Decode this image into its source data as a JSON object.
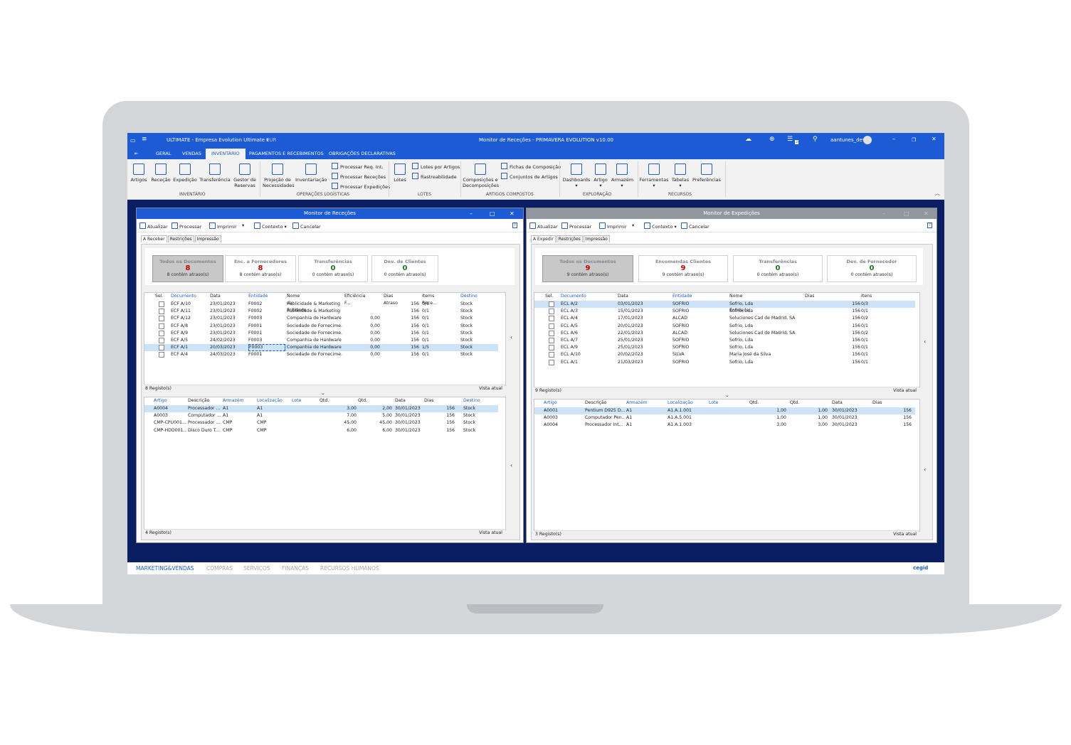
{
  "titlebar": {
    "company": "ULTIMATE - Empresa Evolution Ultimate ▾",
    "currency": "EUR",
    "title": "Monitor de Receções - PRIMAVERA EVOLUTION v10.00",
    "user": "aantunes_dev",
    "notif_count": "2"
  },
  "menu": [
    "GERAL",
    "VENDAS",
    "INVENTÁRIO",
    "PAGAMENTOS E RECEBIMENTOS",
    "OBRIGAÇÕES DECLARATIVAS"
  ],
  "ribbon": {
    "inventario": [
      "Artigos",
      "Receção",
      "Expedição",
      "Transferência",
      "Gestor de\nReservas"
    ],
    "inventario_group": "INVENTÁRIO",
    "oplog": [
      "Projeção de\nNecessidades",
      "Inventariação"
    ],
    "oplog_small": [
      "Processar Req. Int.",
      "Processar Receções",
      "Processar Expedições"
    ],
    "oplog_group": "OPERAÇÕES LOGÍSTICAS",
    "lotes": [
      "Lotes"
    ],
    "lotes_small": [
      "Lotes por Artigos",
      "Rastreabilidade"
    ],
    "lotes_group": "LOTES",
    "compostos": [
      "Composições e\nDecomposições"
    ],
    "compostos_small": [
      "Fichas de Composição",
      "Conjuntos de Artigos"
    ],
    "compostos_group": "ARTIGOS COMPOSTOS",
    "exploracao": [
      "Dashboards",
      "Artigo",
      "Armazém"
    ],
    "exploracao_group": "EXPLORAÇÃO",
    "recursos": [
      "Ferramentas",
      "Tabelas",
      "Preferências"
    ],
    "recursos_group": "RECURSOS"
  },
  "toolbar": {
    "atualizar": "Atualizar",
    "processar": "Processar",
    "imprimir": "Imprimir",
    "imprimir_arrow": "▾",
    "contexto": "Contexto ▾",
    "cancelar": "Cancelar",
    "help": "?"
  },
  "rececoes": {
    "title": "Monitor de Receções",
    "tabs": [
      "A Receber",
      "Restrições",
      "Impressão"
    ],
    "cards": [
      {
        "label": "Todos os Documentos",
        "num": "8",
        "sub": "8 contém atraso(s)",
        "color": "#c00000"
      },
      {
        "label": "Enc. a Fornecedores",
        "num": "8",
        "sub": "8 contém atraso(s)",
        "color": "#c00000"
      },
      {
        "label": "Transferências",
        "num": "0",
        "sub": "0 contém atraso(s)",
        "color": "#1a7a1a"
      },
      {
        "label": "Dev. de Clientes",
        "num": "0",
        "sub": "0 contém atraso(s)",
        "color": "#1a7a1a"
      }
    ],
    "docs_head": [
      "Sel.",
      "Documento",
      "Data",
      "Entidade",
      "Nome da Entidade",
      "Eficiência F...",
      "Dias Atraso",
      "Items Rece...",
      "Destino"
    ],
    "docs": [
      [
        "ECF A/10",
        "23/01/2023",
        "F0002",
        "Publicidade & Marketing",
        "",
        "156",
        "0/1",
        "Stock"
      ],
      [
        "ECF A/11",
        "23/01/2023",
        "F0002",
        "Publicidade & Marketing",
        "",
        "156",
        "0/1",
        "Stock"
      ],
      [
        "ECF A/12",
        "23/01/2023",
        "F0003",
        "Companhia de Hardware",
        "0,00",
        "156",
        "0/1",
        "Stock"
      ],
      [
        "ECF A/8",
        "23/01/2023",
        "F0001",
        "Sociedade de Fornecime...",
        "0,00",
        "156",
        "0/1",
        "Stock"
      ],
      [
        "ECF A/9",
        "23/01/2023",
        "F0001",
        "Sociedade de Fornecime...",
        "0,00",
        "156",
        "0/1",
        "Stock"
      ],
      [
        "ECF A/5",
        "24/02/2023",
        "F0003",
        "Companhia de Hardware",
        "0,00",
        "156",
        "0/1",
        "Stock"
      ],
      [
        "ECF A/1",
        "20/03/2023",
        "F0003",
        "Companhia de Hardware",
        "0,00",
        "156",
        "1/5",
        "Stock"
      ],
      [
        "ECF A/4",
        "24/03/2023",
        "F0001",
        "Sociedade de Fornecime...",
        "0,00",
        "156",
        "0/1",
        "Stock"
      ]
    ],
    "docs_count": "8 Registo(s)",
    "view": "Vista atual",
    "lines_head": [
      "Artigo",
      "Descrição",
      "Armazém",
      "Localização",
      "Lote",
      "Qtd.",
      "Qtd. Pend.",
      "Data Prevista",
      "Dias Atraso",
      "Destino"
    ],
    "lines": [
      [
        "A0004",
        "Processador ...",
        "A1",
        "A1",
        "",
        "3,00",
        "2,00",
        "30/01/2023",
        "156",
        "Stock"
      ],
      [
        "A0003",
        "Computador ...",
        "A1",
        "A1",
        "",
        "7,00",
        "5,00",
        "30/01/2023",
        "156",
        "Stock"
      ],
      [
        "CMP-CPU001...",
        "Processador ...",
        "CMP",
        "CMP",
        "",
        "45,00",
        "45,00",
        "30/01/2023",
        "156",
        "Stock"
      ],
      [
        "CMP-HDD001...",
        "Disco Duro T...",
        "CMP",
        "CMP",
        "",
        "6,00",
        "6,00",
        "30/01/2023",
        "156",
        "Stock"
      ]
    ],
    "lines_count": "4 Registo(s)"
  },
  "expedicoes": {
    "title": "Monitor de Expedições",
    "tabs": [
      "A Expedir",
      "Restrições",
      "Impressão"
    ],
    "cards": [
      {
        "label": "Todos os Documentos",
        "num": "9",
        "sub": "9 contém atraso(s)",
        "color": "#c00000"
      },
      {
        "label": "Encomendas Clientes",
        "num": "9",
        "sub": "9 contém atraso(s)",
        "color": "#c00000"
      },
      {
        "label": "Transferências",
        "num": "0",
        "sub": "0 contém atraso(s)",
        "color": "#1a7a1a"
      },
      {
        "label": "Dev. de Fornecedor",
        "num": "0",
        "sub": "0 contém atraso(s)",
        "color": "#1a7a1a"
      }
    ],
    "docs_head": [
      "Sel.",
      "Documento",
      "Data",
      "Entidade",
      "Nome da Entidade",
      "Dias Atraso",
      "Itens Expedidos"
    ],
    "docs": [
      [
        "ECL A/2",
        "03/01/2023",
        "SOFRIO",
        "Sofrio, Lda",
        "156",
        "0/3"
      ],
      [
        "ECL A/3",
        "15/01/2023",
        "SOFRIO",
        "Sofrio, Lda",
        "156",
        "0/1"
      ],
      [
        "ECL A/4",
        "17/01/2023",
        "ALCAD",
        "Soluciones Cad de Madrid, SA",
        "156",
        "0/2"
      ],
      [
        "ECL A/5",
        "20/01/2023",
        "SOFRIO",
        "Sofrio, Lda",
        "156",
        "0/1"
      ],
      [
        "ECL A/6",
        "22/01/2023",
        "ALCAD",
        "Soluciones Cad de Madrid, SA",
        "156",
        "0/2"
      ],
      [
        "ECL A/7",
        "25/01/2023",
        "SOFRIO",
        "Sofrio, Lda",
        "156",
        "0/1"
      ],
      [
        "ECL A/9",
        "25/01/2023",
        "SOFRIO",
        "Sofrio, Lda",
        "156",
        "0/1"
      ],
      [
        "ECL A/10",
        "20/02/2023",
        "SILVA",
        "Maria José da Silva",
        "156",
        "0/1"
      ],
      [
        "ECL A/1",
        "21/03/2023",
        "SOFRIO",
        "Sofrio, Lda",
        "156",
        "0/1"
      ]
    ],
    "docs_count": "9 Registo(s)",
    "view": "Vista atual",
    "lines_head": [
      "Artigo",
      "Descrição",
      "Armazém",
      "Localização",
      "Lote",
      "Qtd.",
      "Qtd. Pend.",
      "Data Prevista",
      "Dias Atraso"
    ],
    "lines": [
      [
        "A0001",
        "Pentium D925 D...",
        "A1",
        "A1.A.1.001",
        "",
        "1,00",
        "1,00",
        "30/01/2023",
        "156"
      ],
      [
        "A0003",
        "Computador Pen...",
        "A1",
        "A1.A.5.001",
        "",
        "1,00",
        "1,00",
        "30/01/2023",
        "156"
      ],
      [
        "A0004",
        "Processador Int...",
        "A1",
        "A1.A.1.003",
        "",
        "3,00",
        "3,00",
        "30/01/2023",
        "156"
      ]
    ],
    "lines_count": "3 Registo(s)"
  },
  "bottom_tabs": [
    "MARKETING&VENDAS",
    "COMPRAS",
    "SERVIÇOS",
    "FINANÇAS",
    "RECURSOS HUMANOS"
  ],
  "brand": "cegid",
  "colors": {
    "accent": "#1c5bd4",
    "desktop": "#0a1e63",
    "late": "#c00000",
    "ok": "#1a7a1a"
  }
}
